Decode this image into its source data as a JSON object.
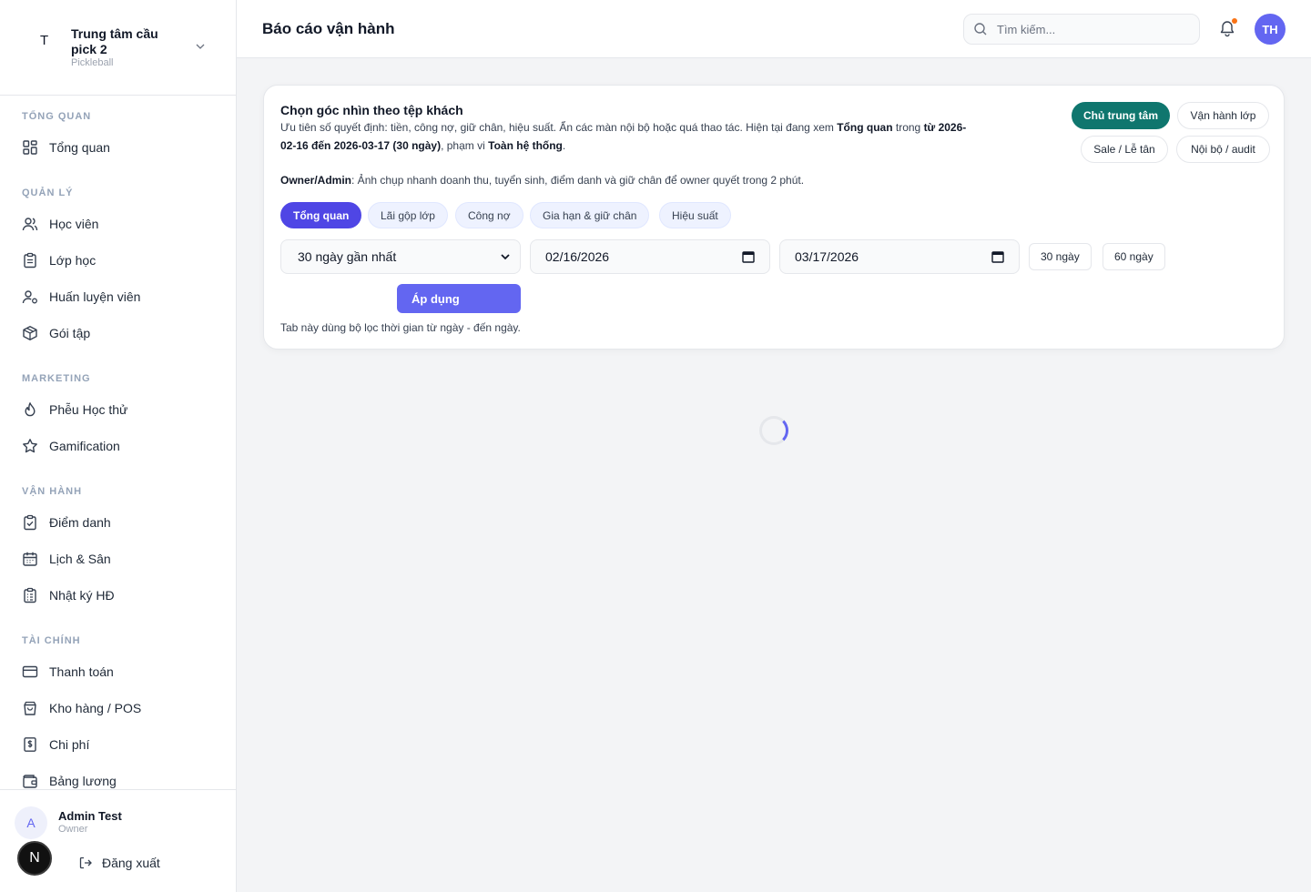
{
  "brand": {
    "initial": "T",
    "name": "Trung tâm cầu pick 2",
    "subtitle": "Pickleball"
  },
  "nav": {
    "sections": [
      {
        "title": "TỔNG QUAN",
        "items": [
          {
            "label": "Tổng quan",
            "icon": "grid-icon"
          }
        ]
      },
      {
        "title": "QUẢN LÝ",
        "items": [
          {
            "label": "Học viên",
            "icon": "users-icon"
          },
          {
            "label": "Lớp học",
            "icon": "clipboard-icon"
          },
          {
            "label": "Huấn luyện viên",
            "icon": "coach-icon"
          },
          {
            "label": "Gói tập",
            "icon": "package-icon"
          }
        ]
      },
      {
        "title": "MARKETING",
        "items": [
          {
            "label": "Phễu Học thử",
            "icon": "flame-icon"
          },
          {
            "label": "Gamification",
            "icon": "star-icon"
          }
        ]
      },
      {
        "title": "VẬN HÀNH",
        "items": [
          {
            "label": "Điểm danh",
            "icon": "clipboard-check-icon"
          },
          {
            "label": "Lịch & Sân",
            "icon": "calendar-icon"
          },
          {
            "label": "Nhật ký HĐ",
            "icon": "clipboard-list-icon"
          }
        ]
      },
      {
        "title": "TÀI CHÍNH",
        "items": [
          {
            "label": "Thanh toán",
            "icon": "credit-card-icon"
          },
          {
            "label": "Kho hàng / POS",
            "icon": "shopping-bag-icon"
          },
          {
            "label": "Chi phí",
            "icon": "receipt-icon"
          },
          {
            "label": "Bảng lương",
            "icon": "wallet-icon"
          }
        ]
      }
    ]
  },
  "user": {
    "initial": "A",
    "name": "Admin Test",
    "role": "Owner",
    "badge": "N",
    "logout_label": "Đăng xuất"
  },
  "header": {
    "title": "Báo cáo vận hành",
    "search_placeholder": "Tìm kiếm...",
    "avatar": "TH"
  },
  "card": {
    "title": "Chọn góc nhìn theo tệp khách",
    "desc_prefix": "Ưu tiên số quyết định: tiền, công nợ, giữ chân, hiệu suất. Ẩn các màn nội bộ hoặc quá thao tác. Hiện tại đang xem ",
    "desc_view": "Tổng quan",
    "desc_mid": " trong ",
    "desc_range": "từ 2026-02-16 đến 2026-03-17 (30 ngày)",
    "desc_scope_prefix": ", phạm vi ",
    "desc_scope": "Toàn hệ thống",
    "desc_end": ".",
    "personas": [
      "Chủ trung tâm",
      "Vận hành lớp",
      "Sale / Lễ tân",
      "Nội bộ / audit"
    ],
    "owner_label": "Owner/Admin",
    "owner_text": ": Ảnh chụp nhanh doanh thu, tuyển sinh, điểm danh và giữ chân để owner quyết trong 2 phút.",
    "tabs": [
      "Tổng quan",
      "Lãi gộp lớp",
      "Công nợ",
      "Gia hạn & giữ chân",
      "Hiệu suất"
    ],
    "range_select": "30 ngày gần nhất",
    "date_from": "02/16/2026",
    "date_to": "03/17/2026",
    "quick_ranges": [
      "30 ngày",
      "60 ngày"
    ],
    "apply_label": "Áp dụng",
    "hint": "Tab này dùng bộ lọc thời gian từ ngày - đến ngày."
  }
}
